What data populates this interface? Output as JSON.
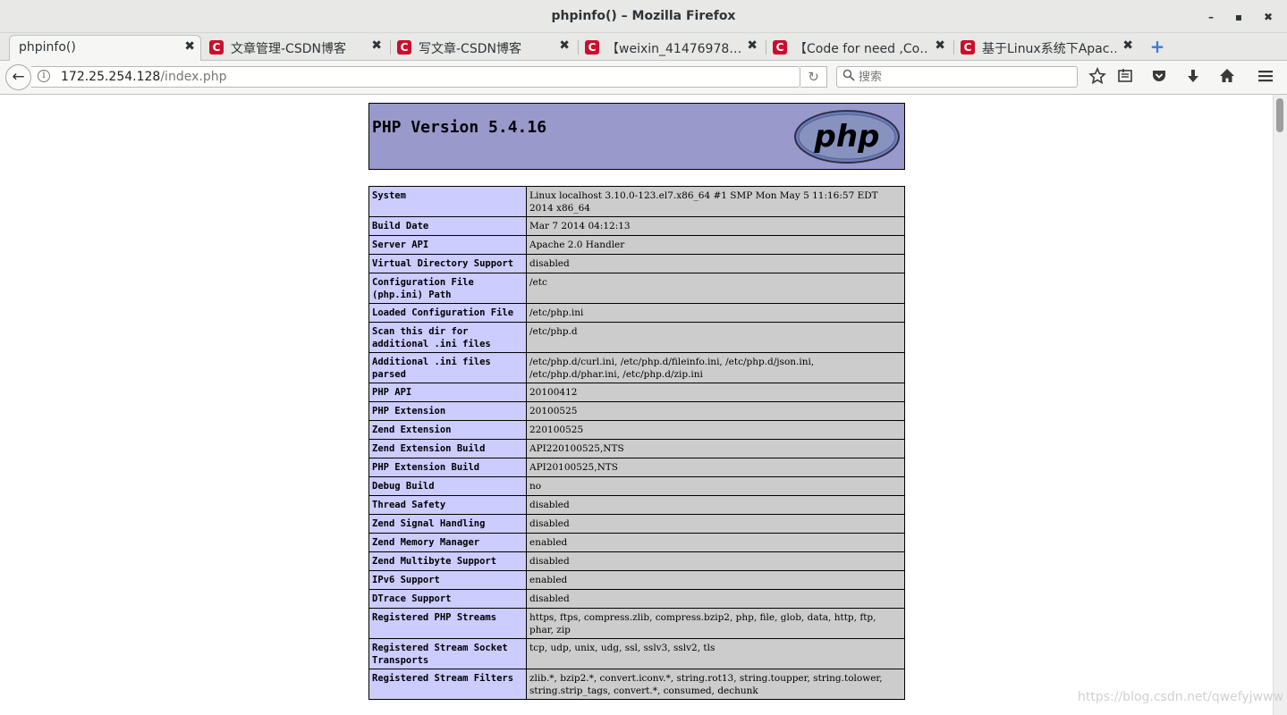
{
  "window": {
    "title": "phpinfo() – Mozilla Firefox",
    "minimize": "–",
    "maximize": "▪",
    "close": "✖"
  },
  "tabs": [
    {
      "label": "phpinfo()",
      "active": true
    },
    {
      "label": "文章管理-CSDN博客",
      "active": false
    },
    {
      "label": "写文章-CSDN博客",
      "active": false
    },
    {
      "label": "【weixin_41476978…",
      "active": false
    },
    {
      "label": "【Code for need ,Co…",
      "active": false
    },
    {
      "label": "基于Linux系统下Apac…",
      "active": false
    }
  ],
  "tab_close": "✖",
  "tab_favicon": "C",
  "new_tab": "+",
  "nav": {
    "back": "←",
    "url_host": "172.25.254.128",
    "url_path": "/index.php",
    "reload": "↻",
    "search_placeholder": "搜索",
    "icons": [
      "bookmark-star-icon",
      "reading-list-icon",
      "pocket-icon",
      "downloads-icon",
      "home-icon",
      "menu-icon"
    ]
  },
  "php": {
    "version_title": "PHP Version 5.4.16",
    "logo_text": "php",
    "rows": [
      {
        "label": "System",
        "value": "Linux localhost 3.10.0-123.el7.x86_64 #1 SMP Mon May 5 11:16:57 EDT 2014 x86_64"
      },
      {
        "label": "Build Date",
        "value": "Mar 7 2014 04:12:13"
      },
      {
        "label": "Server API",
        "value": "Apache 2.0 Handler"
      },
      {
        "label": "Virtual Directory Support",
        "value": "disabled"
      },
      {
        "label": "Configuration File (php.ini) Path",
        "value": "/etc"
      },
      {
        "label": "Loaded Configuration File",
        "value": "/etc/php.ini"
      },
      {
        "label": "Scan this dir for additional .ini files",
        "value": "/etc/php.d"
      },
      {
        "label": "Additional .ini files parsed",
        "value": "/etc/php.d/curl.ini, /etc/php.d/fileinfo.ini, /etc/php.d/json.ini, /etc/php.d/phar.ini, /etc/php.d/zip.ini"
      },
      {
        "label": "PHP API",
        "value": "20100412"
      },
      {
        "label": "PHP Extension",
        "value": "20100525"
      },
      {
        "label": "Zend Extension",
        "value": "220100525"
      },
      {
        "label": "Zend Extension Build",
        "value": "API220100525,NTS"
      },
      {
        "label": "PHP Extension Build",
        "value": "API20100525,NTS"
      },
      {
        "label": "Debug Build",
        "value": "no"
      },
      {
        "label": "Thread Safety",
        "value": "disabled"
      },
      {
        "label": "Zend Signal Handling",
        "value": "disabled"
      },
      {
        "label": "Zend Memory Manager",
        "value": "enabled"
      },
      {
        "label": "Zend Multibyte Support",
        "value": "disabled"
      },
      {
        "label": "IPv6 Support",
        "value": "enabled"
      },
      {
        "label": "DTrace Support",
        "value": "disabled"
      },
      {
        "label": "Registered PHP Streams",
        "value": "https, ftps, compress.zlib, compress.bzip2, php, file, glob, data, http, ftp, phar, zip"
      },
      {
        "label": "Registered Stream Socket Transports",
        "value": "tcp, udp, unix, udg, ssl, sslv3, sslv2, tls"
      },
      {
        "label": "Registered Stream Filters",
        "value": "zlib.*, bzip2.*, convert.iconv.*, string.rot13, string.toupper, string.tolower, string.strip_tags, convert.*, consumed, dechunk"
      }
    ]
  },
  "watermark": "https://blog.csdn.net/qwefyjwww"
}
